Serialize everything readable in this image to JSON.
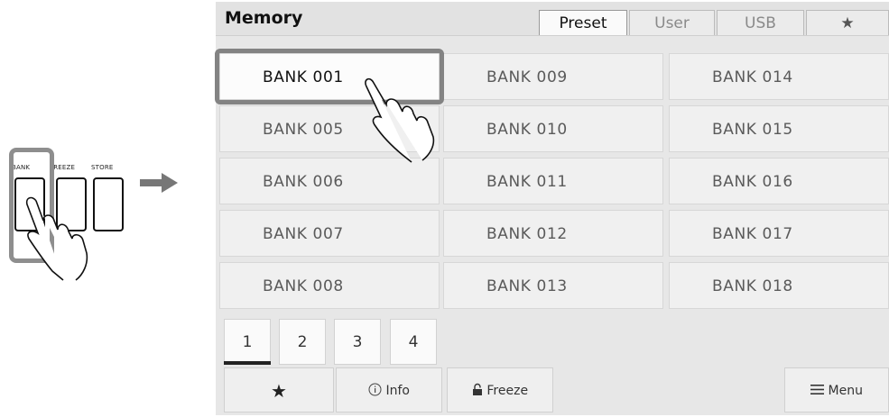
{
  "panel": {
    "buttons": [
      {
        "label": "BANK"
      },
      {
        "label": "FREEZE"
      },
      {
        "label": "STORE"
      }
    ]
  },
  "screen": {
    "title": "Memory",
    "tabs": [
      {
        "label": "Preset",
        "active": true
      },
      {
        "label": "User",
        "active": false
      },
      {
        "label": "USB",
        "active": false
      },
      {
        "label": "★",
        "active": false
      }
    ],
    "banks": [
      [
        "BANK 001",
        "BANK 009",
        "BANK 014"
      ],
      [
        "BANK 005",
        "BANK 010",
        "BANK 015"
      ],
      [
        "BANK 006",
        "BANK 011",
        "BANK 016"
      ],
      [
        "BANK 007",
        "BANK 012",
        "BANK 017"
      ],
      [
        "BANK 008",
        "BANK 013",
        "BANK 018"
      ]
    ],
    "selected_bank": "BANK 001",
    "pages": [
      "1",
      "2",
      "3",
      "4"
    ],
    "active_page": "1",
    "bottom": {
      "favorite_icon": "★",
      "info_label": "Info",
      "freeze_label": "Freeze",
      "menu_label": "Menu"
    }
  },
  "colors": {
    "highlight": "#838383",
    "screen_bg": "#e7e7e7"
  }
}
